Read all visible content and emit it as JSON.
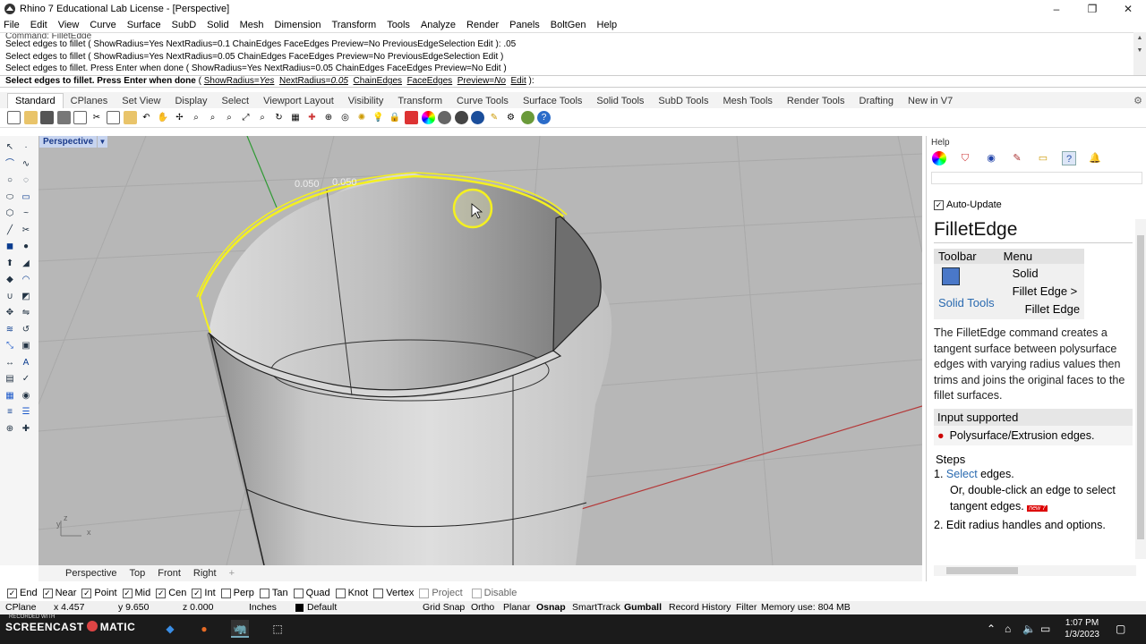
{
  "window": {
    "title": "Rhino 7 Educational Lab License - [Perspective]",
    "controls": [
      "–",
      "❐",
      "✕"
    ]
  },
  "menu": [
    "File",
    "Edit",
    "View",
    "Curve",
    "Surface",
    "SubD",
    "Solid",
    "Mesh",
    "Dimension",
    "Transform",
    "Tools",
    "Analyze",
    "Render",
    "Panels",
    "BoltGen",
    "Help"
  ],
  "command_history": {
    "cut_line": "Command: FilletEdge",
    "lines": [
      "Select edges to fillet ( ShowRadius=Yes  NextRadius=0.1  ChainEdges  FaceEdges  Preview=No  PreviousEdgeSelection  Edit ): .05",
      "Select edges to fillet ( ShowRadius=Yes  NextRadius=0.05  ChainEdges  FaceEdges  Preview=No  PreviousEdgeSelection  Edit )",
      "Select edges to fillet. Press Enter when done ( ShowRadius=Yes  NextRadius=0.05  ChainEdges  FaceEdges  Preview=No  Edit )"
    ]
  },
  "command_prompt": {
    "prefix": "Select edges to fillet. Press Enter when done",
    "open": " ( ",
    "opt1_name": "ShowRadius=",
    "opt1_val": "Yes",
    "opt2_name": "NextRadius=",
    "opt2_val": "0.05",
    "opt3": "ChainEdges",
    "opt4": "FaceEdges",
    "opt5_name": "Preview=",
    "opt5_val": "No",
    "opt6": "Edit",
    "close": " ):"
  },
  "tabs": [
    "Standard",
    "CPlanes",
    "Set View",
    "Display",
    "Select",
    "Viewport Layout",
    "Visibility",
    "Transform",
    "Curve Tools",
    "Surface Tools",
    "Solid Tools",
    "SubD Tools",
    "Mesh Tools",
    "Render Tools",
    "Drafting",
    "New in V7"
  ],
  "active_tab": "Standard",
  "viewport": {
    "label": "Perspective",
    "radius_labels": [
      "0.050",
      "0.050"
    ],
    "axis_labels": {
      "y": "y",
      "z": "z",
      "x": "x"
    },
    "tabs": [
      "Perspective",
      "Top",
      "Front",
      "Right"
    ],
    "add": "+"
  },
  "help_panel": {
    "title": "Help",
    "auto_update": "Auto-Update",
    "heading": "FilletEdge",
    "table_headers": [
      "Toolbar",
      "Menu"
    ],
    "toolbar_link": "Solid Tools",
    "menu_path": [
      "Solid",
      "Fillet Edge >",
      "Fillet Edge"
    ],
    "description": "The FilletEdge command creates a tangent surface between polysurface edges with varying radius values then trims and joins the original faces to the fillet surfaces.",
    "input_heading": "Input supported",
    "input_item": "Polysurface/Extrusion edges.",
    "steps_heading": "Steps",
    "step1_num": "1.",
    "step1_link": "Select",
    "step1_rest": " edges.",
    "step1_sub": "Or, double-click an edge to select tangent edges.",
    "new_badge": "new 7",
    "step2": "2. Edit radius handles and options."
  },
  "osnap": [
    {
      "label": "End",
      "checked": true
    },
    {
      "label": "Near",
      "checked": true
    },
    {
      "label": "Point",
      "checked": true
    },
    {
      "label": "Mid",
      "checked": true
    },
    {
      "label": "Cen",
      "checked": true
    },
    {
      "label": "Int",
      "checked": true
    },
    {
      "label": "Perp",
      "checked": false
    },
    {
      "label": "Tan",
      "checked": false
    },
    {
      "label": "Quad",
      "checked": false
    },
    {
      "label": "Knot",
      "checked": false
    },
    {
      "label": "Vertex",
      "checked": false
    },
    {
      "label": "Project",
      "checked": false
    },
    {
      "label": "Disable",
      "checked": false
    }
  ],
  "status": {
    "cplane": "CPlane",
    "x": "x 4.457",
    "y": "y 9.650",
    "z": "z 0.000",
    "units": "Inches",
    "layer": "Default",
    "grid_snap": "Grid Snap",
    "ortho": "Ortho",
    "planar": "Planar",
    "osnap": "Osnap",
    "smarttrack": "SmartTrack",
    "gumball": "Gumball",
    "record_history": "Record History",
    "filter": "Filter",
    "memory": "Memory use: 804 MB"
  },
  "taskbar": {
    "screencast": "SCREENCAST",
    "matic": "MATIC",
    "recorded": "RECORDED WITH",
    "time": "1:07 PM",
    "date": "1/3/2023"
  },
  "colors": {
    "selection": "#f4f020",
    "viewport_bg": "#b7b7b7",
    "grid_line": "#a6a6a6",
    "x_axis": "#b43838",
    "y_axis": "#2f9a34",
    "link": "#2a6ab0"
  }
}
